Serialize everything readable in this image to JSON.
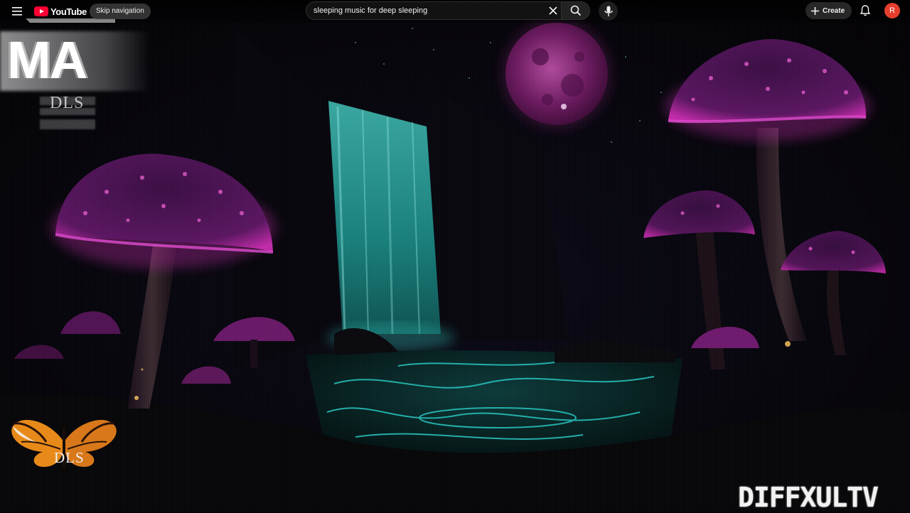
{
  "masthead": {
    "logo_text": "YouTube",
    "skip_nav_label": "Skip navigation",
    "search": {
      "value": "sleeping music for deep sleeping"
    },
    "create_label": "Create",
    "avatar_letter": "R"
  },
  "overlays": {
    "channel_logo_text": "MA",
    "dls_small_text": "DLS",
    "butterfly_logo_text": "DLS",
    "channel_watermark": "DIFFXULTV"
  },
  "icons": [
    "menu-icon",
    "youtube-logo-icon",
    "clear-icon",
    "search-icon",
    "mic-icon",
    "plus-icon",
    "bell-icon"
  ],
  "colors": {
    "brand_red": "#ff0033",
    "avatar_bg": "#e53e2c",
    "mushroom_glow": "#b0289a",
    "water_glow": "#1ec8c0",
    "moon": "#8a2a78"
  }
}
